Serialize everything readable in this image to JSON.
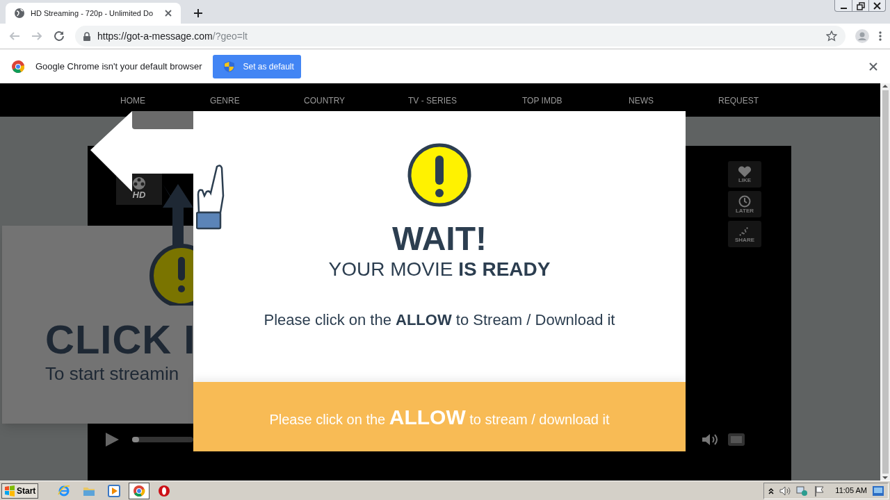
{
  "browser": {
    "tab": {
      "title": "HD Streaming - 720p - Unlimited Do",
      "selected": true
    },
    "url": {
      "host": "https://got-a-message.com",
      "rest": "/?geo=lt"
    },
    "infobar": {
      "message": "Google Chrome isn't your default browser",
      "button": "Set as default"
    }
  },
  "site": {
    "nav": [
      "HOME",
      "GENRE",
      "COUNTRY",
      "TV - SERIES",
      "TOP IMDB",
      "NEWS",
      "REQUEST"
    ],
    "player": {
      "logo": "HD",
      "side_buttons": [
        {
          "label": "LIKE",
          "kind": "heart"
        },
        {
          "label": "LATER",
          "kind": "clock"
        },
        {
          "label": "SHARE",
          "kind": "share"
        }
      ],
      "progress": {
        "level": 0.03
      }
    },
    "behind": {
      "title": "CLICK I",
      "subtitle": "To start streamin"
    },
    "modal": {
      "title": "WAIT!",
      "subtitle": "YOUR MOVIE **IS READY**",
      "message": "Please click on the **ALLOW** to Stream / Download it",
      "banner": "Please click on the **ALLOW** to stream / download it"
    }
  },
  "taskbar": {
    "start": "Start",
    "apps": [
      {
        "kind": "ie",
        "selected": false
      },
      {
        "kind": "folder",
        "selected": false
      },
      {
        "kind": "media",
        "selected": false
      },
      {
        "kind": "chrome",
        "selected": true
      },
      {
        "kind": "opera",
        "selected": false
      }
    ],
    "clock": "11:05 AM"
  }
}
